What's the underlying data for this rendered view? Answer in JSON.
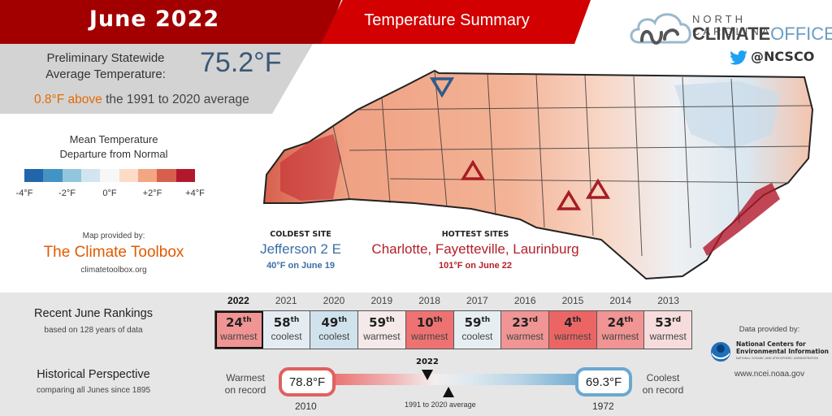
{
  "header": {
    "month": "June 2022",
    "subtitle": "Temperature Summary"
  },
  "statewide": {
    "label_line1": "Preliminary Statewide",
    "label_line2": "Average Temperature:",
    "value": "75.2°F",
    "anomaly_value": "0.8°F above",
    "anomaly_rest": " the 1991 to 2020 average"
  },
  "branding": {
    "logo_line1": "NORTH CAROLINA",
    "logo_bold": "CLIMATE",
    "logo_light": "OFFICE",
    "twitter_handle": "@NCSCO",
    "icon": "twitter-bird-icon"
  },
  "legend": {
    "title_line1": "Mean Temperature",
    "title_line2": "Departure from Normal",
    "colors": [
      "#2166ac",
      "#4393c3",
      "#92c5de",
      "#d1e5f0",
      "#f7f7f7",
      "#fddbc7",
      "#f4a582",
      "#d6604d",
      "#b2182b"
    ],
    "ticks": [
      {
        "label": "-4°F",
        "value": -4
      },
      {
        "label": "-2°F",
        "value": -2
      },
      {
        "label": "0°F",
        "value": 0
      },
      {
        "label": "+2°F",
        "value": 2
      },
      {
        "label": "+4°F",
        "value": 4
      }
    ]
  },
  "map_credit": {
    "label": "Map provided by:",
    "name": "The Climate Toolbox",
    "url": "climatetoolbox.org"
  },
  "map": {
    "description": "North Carolina county map of June 2022 mean temperature departure from normal",
    "coldest_marker": "Jefferson 2 E",
    "hottest_markers": [
      "Charlotte",
      "Fayetteville",
      "Laurinburg"
    ]
  },
  "coldest": {
    "heading": "COLDEST SITE",
    "name": "Jefferson 2 E",
    "detail": "40°F on June 19"
  },
  "hottest": {
    "heading": "HOTTEST SITES",
    "name": "Charlotte, Fayetteville, Laurinburg",
    "detail": "101°F on June 22"
  },
  "rankings": {
    "title": "Recent June Rankings",
    "subtitle": "based on 128 years of data",
    "items": [
      {
        "year": "2022",
        "rank": "24",
        "suffix": "th",
        "kind": "warmest",
        "color": "#f09494",
        "current": true
      },
      {
        "year": "2021",
        "rank": "58",
        "suffix": "th",
        "kind": "coolest",
        "color": "#e4ecf2",
        "current": false
      },
      {
        "year": "2020",
        "rank": "49",
        "suffix": "th",
        "kind": "coolest",
        "color": "#d0e2ec",
        "current": false
      },
      {
        "year": "2019",
        "rank": "59",
        "suffix": "th",
        "kind": "warmest",
        "color": "#f5e9e9",
        "current": false
      },
      {
        "year": "2018",
        "rank": "10",
        "suffix": "th",
        "kind": "warmest",
        "color": "#ee7272",
        "current": false
      },
      {
        "year": "2017",
        "rank": "59",
        "suffix": "th",
        "kind": "coolest",
        "color": "#e6eef2",
        "current": false
      },
      {
        "year": "2016",
        "rank": "23",
        "suffix": "rd",
        "kind": "warmest",
        "color": "#f09494",
        "current": false
      },
      {
        "year": "2015",
        "rank": "4",
        "suffix": "th",
        "kind": "warmest",
        "color": "#ec6565",
        "current": false
      },
      {
        "year": "2014",
        "rank": "24",
        "suffix": "th",
        "kind": "warmest",
        "color": "#f09494",
        "current": false
      },
      {
        "year": "2013",
        "rank": "53",
        "suffix": "rd",
        "kind": "warmest",
        "color": "#f6dcdc",
        "current": false
      }
    ]
  },
  "historical": {
    "title": "Historical Perspective",
    "subtitle": "comparing all Junes since 1895",
    "warmest_label_1": "Warmest",
    "warmest_label_2": "on record",
    "warmest_value": "78.8°F",
    "warmest_year": "2010",
    "coolest_label_1": "Coolest",
    "coolest_label_2": "on record",
    "coolest_value": "69.3°F",
    "coolest_year": "1972",
    "marker_label": "2022",
    "average_label": "1991 to 2020 average"
  },
  "data_credit": {
    "label": "Data provided by:",
    "org_line1": "National Centers for",
    "org_line2": "Environmental Information",
    "org_line3": "NATIONAL OCEANIC AND ATMOSPHERIC ADMINISTRATION",
    "url": "www.ncei.noaa.gov"
  }
}
